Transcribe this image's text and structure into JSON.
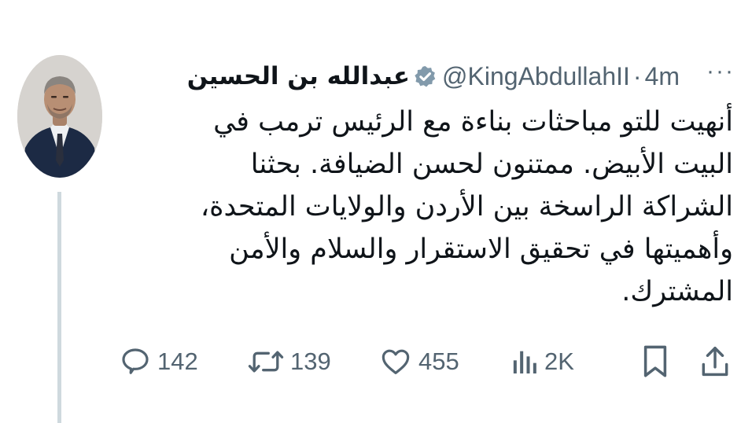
{
  "tweet": {
    "display_name": "عبدالله بن الحسين",
    "handle": "@KingAbdullahII",
    "separator": "·",
    "time": "4m",
    "more_label": "···",
    "text": "أنهيت للتو مباحثات بناءة مع الرئيس ترمب في البيت الأبيض. ممتنون لحسن الضيافة. بحثنا الشراكة الراسخة بين الأردن والولايات المتحدة، وأهميتها في تحقيق الاستقرار والسلام والأمن المشترك."
  },
  "actions": {
    "replies": "142",
    "reposts": "139",
    "likes": "455",
    "views": "2K"
  },
  "icons": {
    "verified": "verified-badge-icon",
    "more": "more-horizontal-icon",
    "reply": "reply-icon",
    "repost": "repost-icon",
    "like": "heart-icon",
    "views": "views-chart-icon",
    "bookmark": "bookmark-icon",
    "share": "share-icon"
  },
  "colors": {
    "text": "#0f1419",
    "secondary": "#536471",
    "verified_badge": "#829aab",
    "thread_line": "#cfd9de"
  }
}
